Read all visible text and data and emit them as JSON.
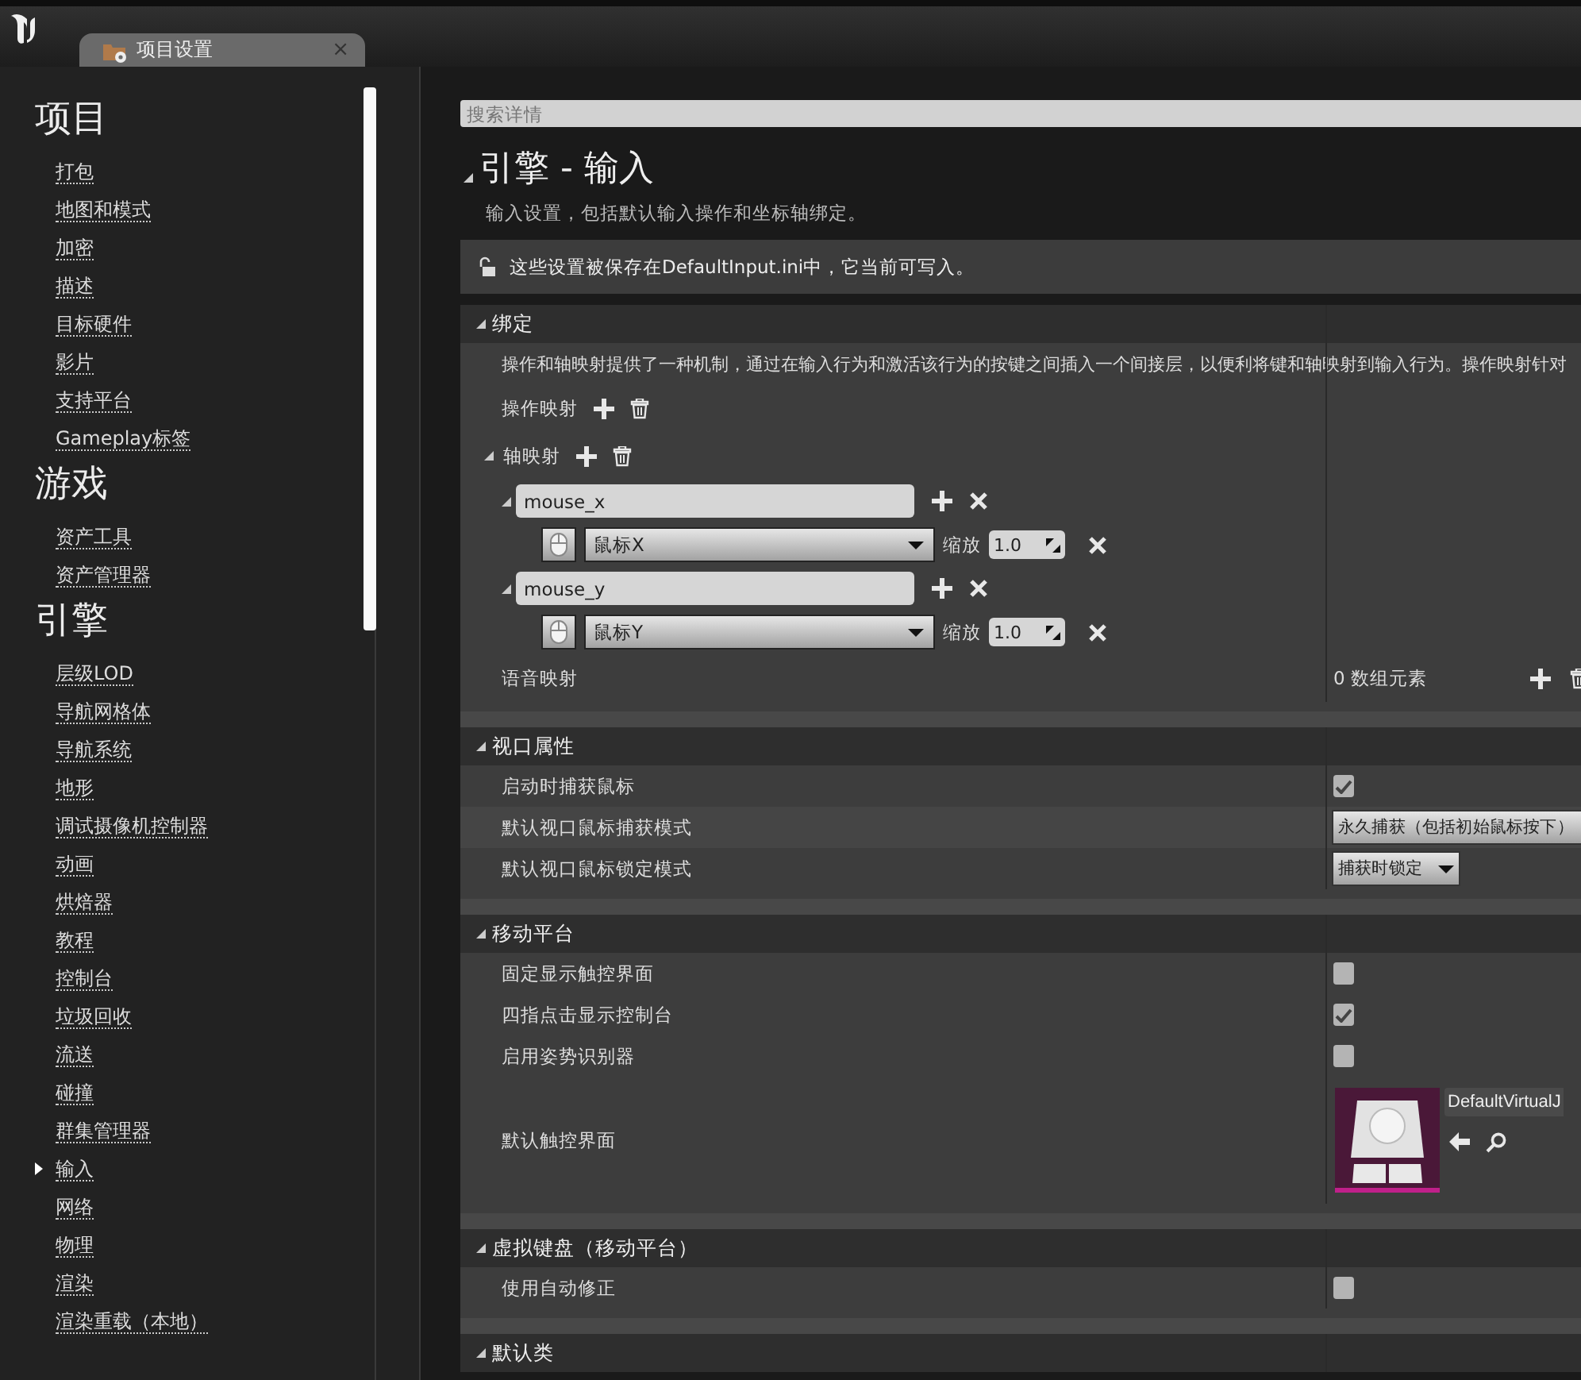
{
  "tab": {
    "title": "项目设置",
    "close": "×"
  },
  "sidebar": {
    "groups": [
      {
        "heading": "项目",
        "items": [
          {
            "label": "打包",
            "selected": false
          },
          {
            "label": "地图和模式",
            "selected": false
          },
          {
            "label": "加密",
            "selected": false
          },
          {
            "label": "描述",
            "selected": false
          },
          {
            "label": "目标硬件",
            "selected": false
          },
          {
            "label": "影片",
            "selected": false
          },
          {
            "label": "支持平台",
            "selected": false
          },
          {
            "label": "Gameplay标签",
            "selected": false
          }
        ]
      },
      {
        "heading": "游戏",
        "items": [
          {
            "label": "资产工具",
            "selected": false
          },
          {
            "label": "资产管理器",
            "selected": false
          }
        ]
      },
      {
        "heading": "引擎",
        "items": [
          {
            "label": "层级LOD",
            "selected": false
          },
          {
            "label": "导航网格体",
            "selected": false
          },
          {
            "label": "导航系统",
            "selected": false
          },
          {
            "label": "地形",
            "selected": false
          },
          {
            "label": "调试摄像机控制器",
            "selected": false
          },
          {
            "label": "动画",
            "selected": false
          },
          {
            "label": "烘焙器",
            "selected": false
          },
          {
            "label": "教程",
            "selected": false
          },
          {
            "label": "控制台",
            "selected": false
          },
          {
            "label": "垃圾回收",
            "selected": false
          },
          {
            "label": "流送",
            "selected": false
          },
          {
            "label": "碰撞",
            "selected": false
          },
          {
            "label": "群集管理器",
            "selected": false
          },
          {
            "label": "输入",
            "selected": true
          },
          {
            "label": "网络",
            "selected": false
          },
          {
            "label": "物理",
            "selected": false
          },
          {
            "label": "渲染",
            "selected": false
          },
          {
            "label": "渲染重载（本地）",
            "selected": false
          }
        ]
      }
    ]
  },
  "search": {
    "placeholder": "搜索详情"
  },
  "page": {
    "title": "引擎 - 输入",
    "expanded": true,
    "description": "输入设置，包括默认输入操作和坐标轴绑定。"
  },
  "notice": {
    "text": "这些设置被保存在DefaultInput.ini中，它当前可写入。"
  },
  "sections": [
    {
      "title": "绑定",
      "expanded": true,
      "rows": [
        {
          "kind": "note",
          "text": "操作和轴映射提供了一种机制，通过在输入行为和激活该行为的按键之间插入一个间接层，以便利将键和轴映射到输入行为。操作映射针对"
        },
        {
          "kind": "action_mappings",
          "label": "操作映射"
        },
        {
          "kind": "axis_mappings",
          "label": "轴映射",
          "expanded": true,
          "mappings": [
            {
              "name": "mouse_x",
              "expanded": true,
              "keys": [
                {
                  "key": "鼠标X",
                  "scale_label": "缩放",
                  "scale": "1.0"
                }
              ]
            },
            {
              "name": "mouse_y",
              "expanded": true,
              "keys": [
                {
                  "key": "鼠标Y",
                  "scale_label": "缩放",
                  "scale": "1.0"
                }
              ]
            }
          ]
        },
        {
          "kind": "array",
          "label": "语音映射",
          "value": "0 数组元素"
        }
      ]
    },
    {
      "title": "视口属性",
      "expanded": true,
      "rows": [
        {
          "kind": "checkbox",
          "label": "启动时捕获鼠标",
          "checked": true
        },
        {
          "kind": "dropdown",
          "label": "默认视口鼠标捕获模式",
          "value": "永久捕获（包括初始鼠标按下）"
        },
        {
          "kind": "dropdown",
          "label": "默认视口鼠标锁定模式",
          "value": "捕获时锁定"
        }
      ]
    },
    {
      "title": "移动平台",
      "expanded": true,
      "rows": [
        {
          "kind": "checkbox",
          "label": "固定显示触控界面",
          "checked": false
        },
        {
          "kind": "checkbox",
          "label": "四指点击显示控制台",
          "checked": true
        },
        {
          "kind": "checkbox",
          "label": "启用姿势识别器",
          "checked": false
        },
        {
          "kind": "asset",
          "label": "默认触控界面",
          "asset_name": "DefaultVirtualJ"
        }
      ]
    },
    {
      "title": "虚拟键盘（移动平台）",
      "expanded": true,
      "rows": [
        {
          "kind": "checkbox",
          "label": "使用自动修正",
          "checked": false
        }
      ]
    },
    {
      "title": "默认类",
      "expanded": true
    }
  ]
}
